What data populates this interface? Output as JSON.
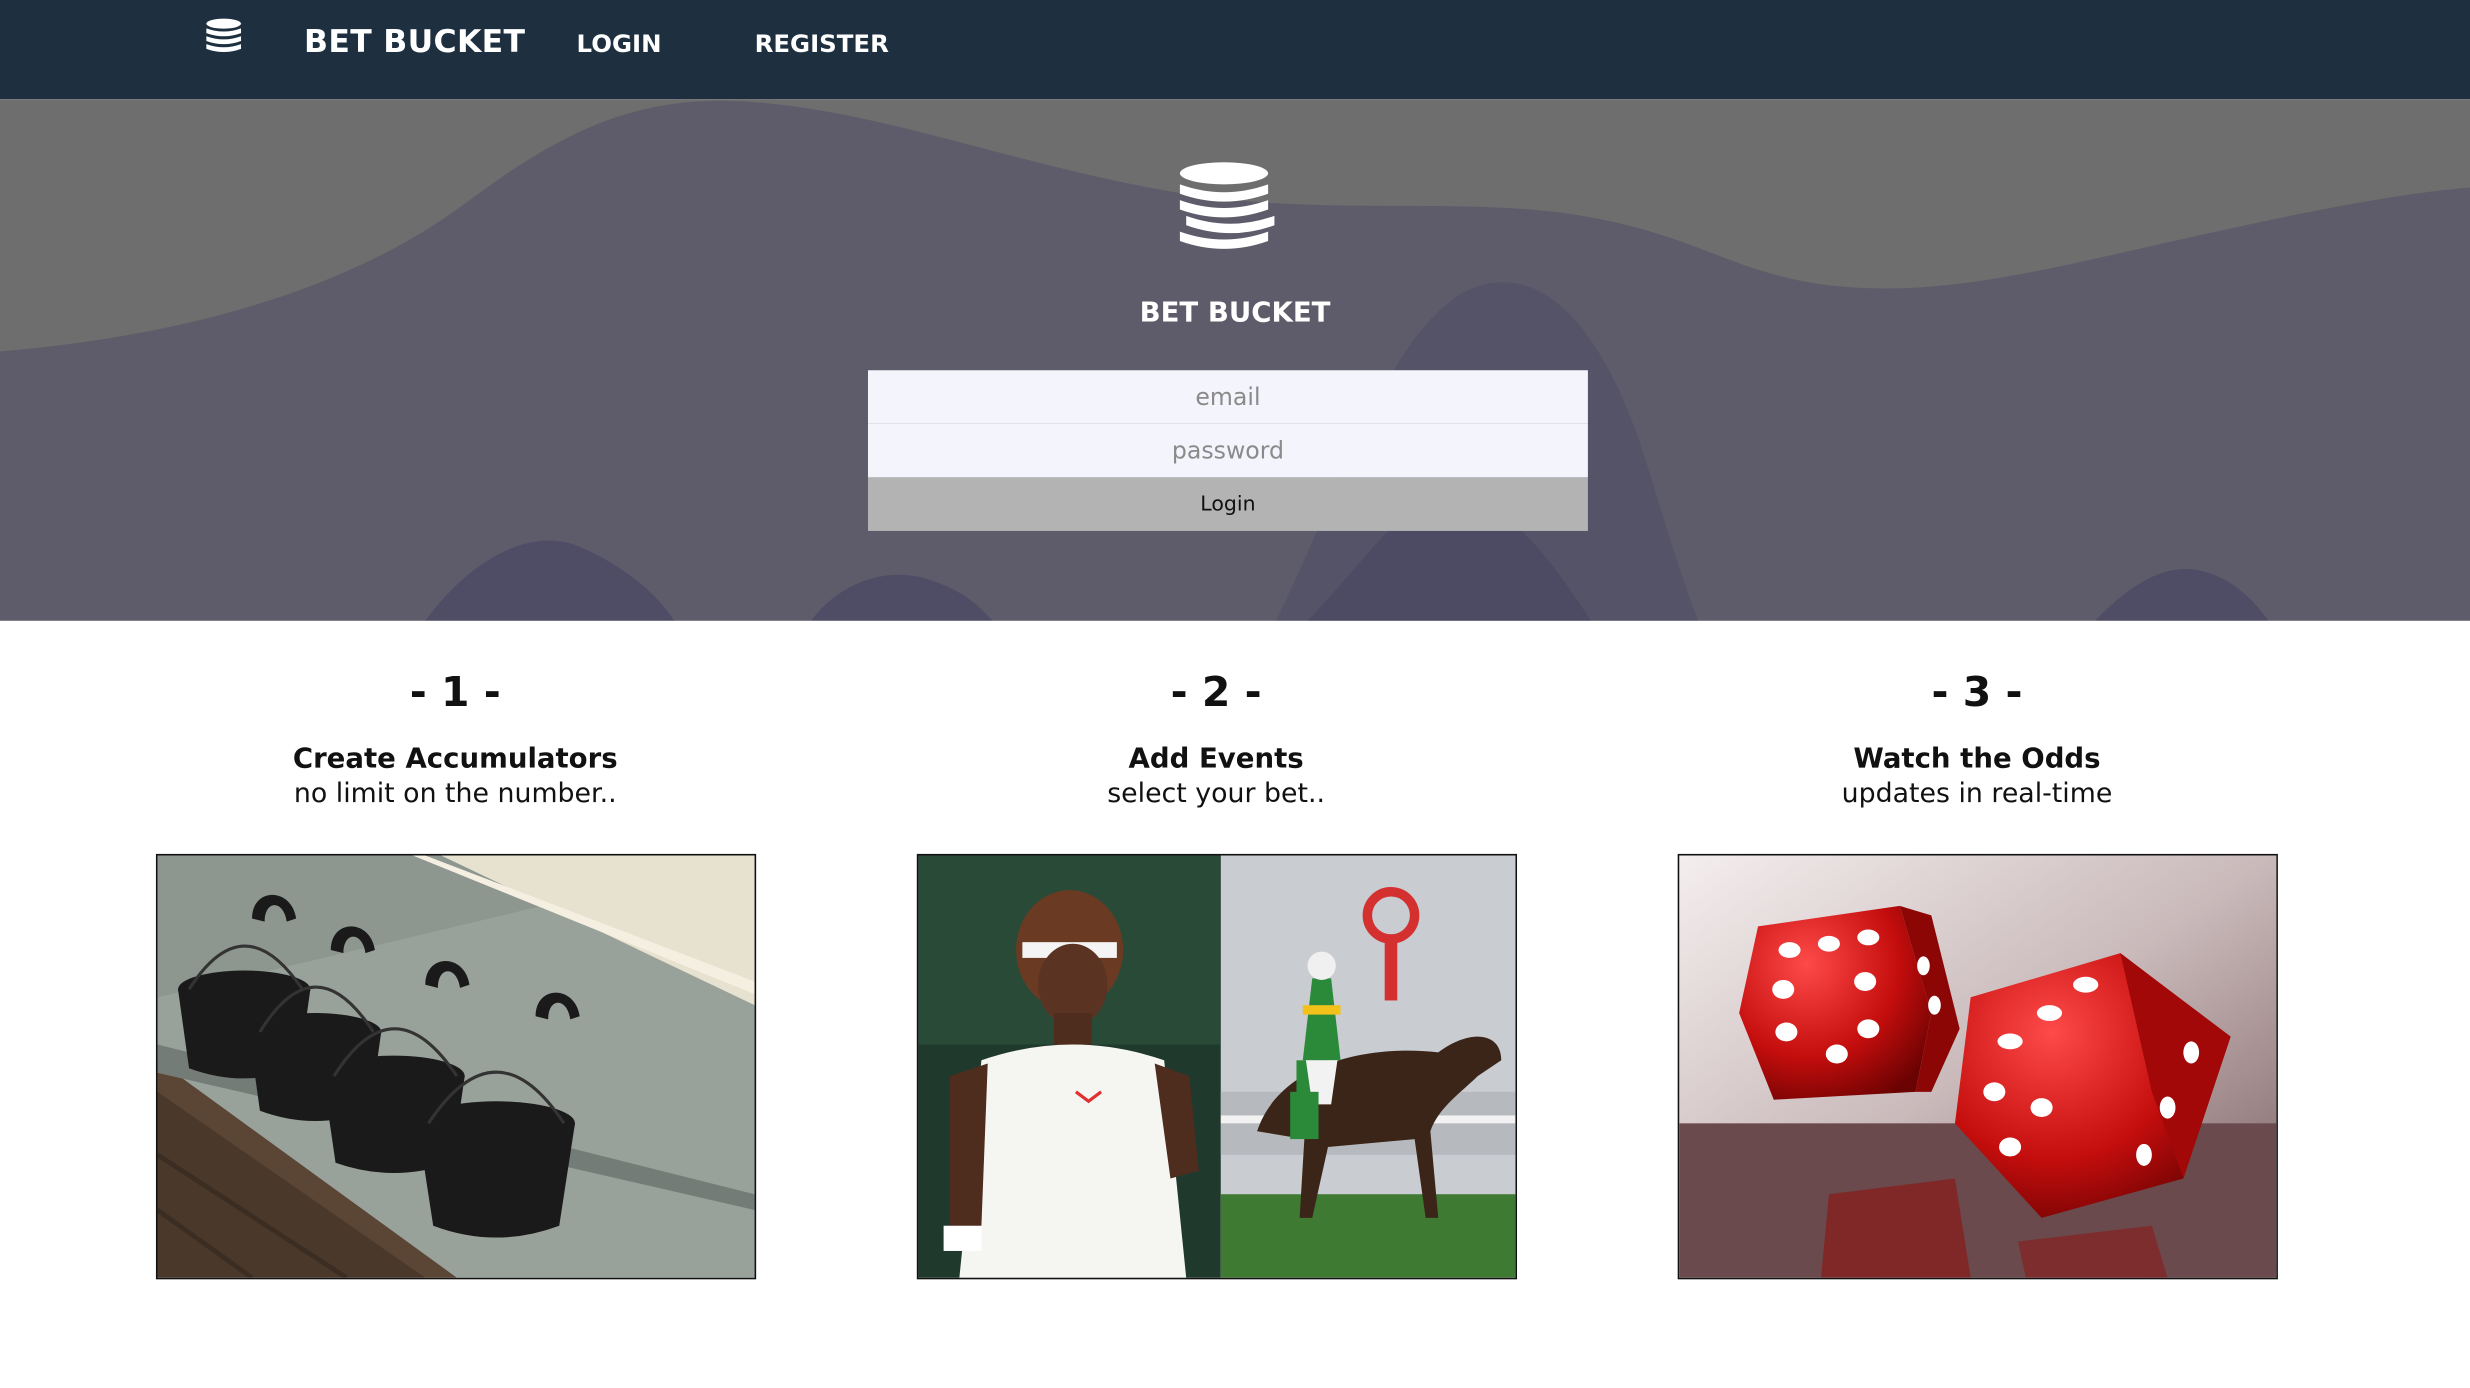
{
  "navbar": {
    "logo_icon": "coin-stack-icon",
    "brand": "BET BUCKET",
    "login_label": "LOGIN",
    "register_label": "REGISTER",
    "background": "#1e3040"
  },
  "hero": {
    "logo_icon": "coin-stack-icon",
    "title": "BET BUCKET",
    "email_placeholder": "email",
    "password_placeholder": "password",
    "login_button_label": "Login"
  },
  "features": [
    {
      "number": "- 1 -",
      "title": "Create Accumulators",
      "subtitle": "no limit on the number..",
      "image_icon": "buckets-on-hooks-photo"
    },
    {
      "number": "- 2 -",
      "title": "Add Events",
      "subtitle": "select your bet..",
      "image_icon": "tennis-and-horse-racing-photo"
    },
    {
      "number": "- 3 -",
      "title": "Watch the Odds",
      "subtitle": "updates in real-time",
      "image_icon": "red-dice-photo"
    }
  ]
}
